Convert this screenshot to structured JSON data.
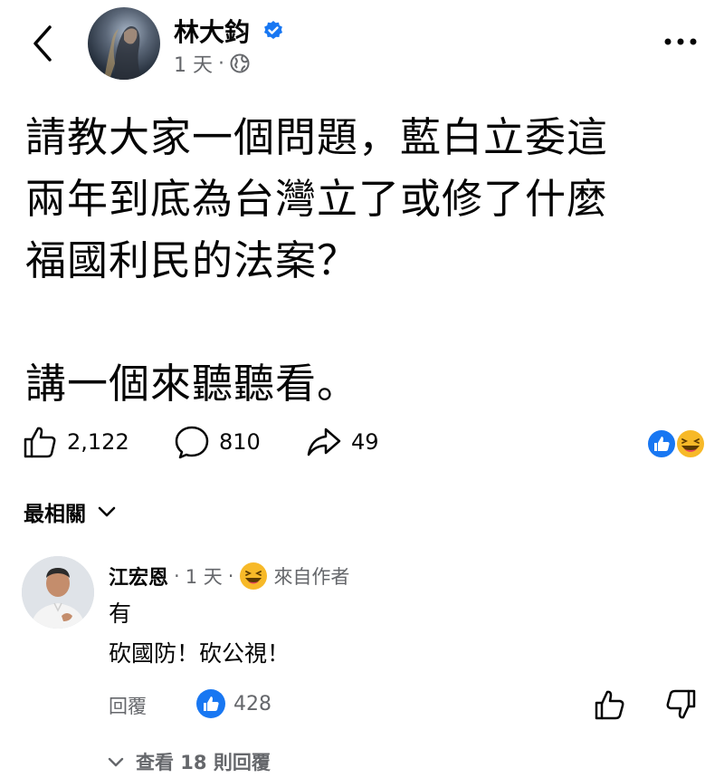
{
  "post": {
    "author": "林大鈞",
    "time": "1 天",
    "dot": "·",
    "body_lines": [
      "請教大家一個問題，藍白立委這",
      "兩年到底為台灣立了或修了什麼",
      "福國利民的法案？",
      "講一個來聽聽看。"
    ]
  },
  "actions": {
    "likes": "2,122",
    "comments": "810",
    "shares": "49"
  },
  "sort": {
    "label": "最相關"
  },
  "comment": {
    "author": "江宏恩",
    "dot": "·",
    "time": "1 天",
    "dot2": "·",
    "badge": "來自作者",
    "lines": [
      "有",
      "砍國防！砍公視！"
    ],
    "reply_label": "回覆",
    "likes": "428"
  },
  "view_replies": {
    "label": "查看 18 則回覆"
  },
  "colors": {
    "accent": "#1877f2",
    "secondary_text": "#65676b",
    "laugh": "#f7b928"
  }
}
